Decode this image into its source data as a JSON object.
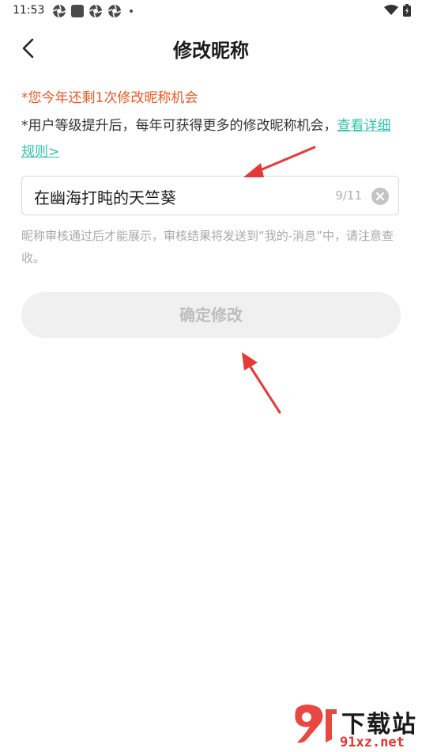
{
  "status_bar": {
    "time": "11:53",
    "icons": [
      "aperture-icon",
      "app-square-icon",
      "aperture-icon",
      "aperture-icon",
      "dot-icon"
    ],
    "right_icons": [
      "wifi-icon",
      "battery-icon"
    ]
  },
  "header": {
    "title": "修改昵称",
    "back_icon": "chevron-left-icon"
  },
  "notices": {
    "remaining": "*您今年还剩1次修改昵称机会",
    "upgrade_text": "*用户等级提升后，每年可获得更多的修改昵称机会，",
    "rules_link": "查看详细规则>"
  },
  "nickname": {
    "value": "在幽海打盹的天竺葵",
    "counter": "9/11",
    "clear_icon": "clear-circle-icon"
  },
  "review_hint": "昵称审核通过后才能展示，审核结果将发送到“我的-消息”中，请注意查收。",
  "confirm_button": {
    "label": "确定修改",
    "enabled": false
  },
  "watermark": {
    "logo_text": "9f",
    "title": "下载站",
    "domain": "91xz.net"
  },
  "colors": {
    "accent_red": "#f2571f",
    "link_teal": "#2ec4a8",
    "annotation_arrow": "#e53935"
  }
}
